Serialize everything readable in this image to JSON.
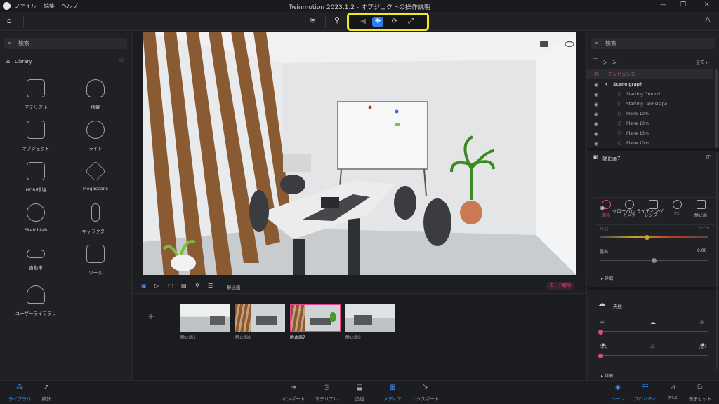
{
  "titlebar": {
    "menus": [
      "ファイル",
      "編集",
      "ヘルプ"
    ],
    "title": "Twinmotion 2023.1.2 - オブジェクトの操作説明"
  },
  "colors": {
    "accent": "#3d8ef0",
    "highlight": "#f0ea1b",
    "pink": "#e8458f"
  },
  "left_panel": {
    "search_placeholder": "検索",
    "library_label": "Library",
    "items": [
      {
        "label": "マテリアル",
        "icon": "material-swatch-icon"
      },
      {
        "label": "植栽",
        "icon": "tree-icon"
      },
      {
        "label": "オブジェクト",
        "icon": "sofa-icon"
      },
      {
        "label": "ライト",
        "icon": "lightbulb-icon"
      },
      {
        "label": "HDRI環境",
        "icon": "hdri-image-icon"
      },
      {
        "label": "Megascans",
        "icon": "megascans-icon"
      },
      {
        "label": "Sketchfab",
        "icon": "sketchfab-icon"
      },
      {
        "label": "キャラクター",
        "icon": "character-icon"
      },
      {
        "label": "自動車",
        "icon": "car-icon"
      },
      {
        "label": "ツール",
        "icon": "tools-cube-icon"
      },
      {
        "label": "ユーザーライブラリ",
        "icon": "user-library-icon"
      }
    ]
  },
  "media_bar": {
    "still_label": "静止画",
    "mode_button": "モード解除"
  },
  "thumbnails": [
    "静止画1",
    "静止画8",
    "静止画7",
    "静止画9"
  ],
  "right_panel": {
    "search_placeholder": "検索",
    "scene_label": "シーン",
    "scene_filter": "全て",
    "ambience": "アンビエンス",
    "scene_graph": "Scene graph",
    "tree": [
      "Starting Ground",
      "Starting Landscape",
      "Plane 10m",
      "Plane 10m",
      "Plane 10m",
      "Plane 10m"
    ],
    "selected_label": "静止画7",
    "tabs": [
      "環境",
      "カメラ",
      "レンダー",
      "FX",
      "静止画"
    ],
    "global_lighting": "グローバル ライティング",
    "time_label": "時刻",
    "time_value": "10:30",
    "exposure_label": "露出",
    "exposure_value": "0.00",
    "details": "詳細",
    "weather": "天候",
    "details2": "詳細",
    "time_fraction": 0.44,
    "exposure_fraction": 0.5
  },
  "bottom_bar": {
    "left": [
      {
        "label": "ライブラリ",
        "active": true
      },
      {
        "label": "統計",
        "active": false
      }
    ],
    "center": [
      {
        "label": "インポート",
        "active": false
      },
      {
        "label": "マテリアル",
        "active": false
      },
      {
        "label": "追加",
        "active": false
      },
      {
        "label": "メディア",
        "active": true
      },
      {
        "label": "エクスポート",
        "active": false
      }
    ],
    "right": [
      {
        "label": "シーン",
        "active": true
      },
      {
        "label": "プロパティ",
        "active": true
      },
      {
        "label": "XYZ",
        "active": false
      },
      {
        "label": "表示セット",
        "active": false
      }
    ]
  }
}
